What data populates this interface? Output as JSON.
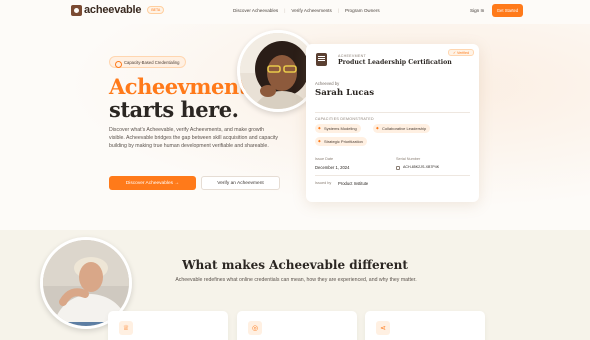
{
  "nav": {
    "logo": "acheevable",
    "beta": "BETA",
    "links": [
      "Discover Acheevables",
      "Verify Acheevments",
      "Program Owners"
    ],
    "sign_in": "Sign In",
    "get_started": "Get Started"
  },
  "hero": {
    "badge": "Capacity-Based Credentialing",
    "title_accent": "Acheevment",
    "title_rest": "starts here.",
    "description": "Discover what's Acheevable, verify Acheevments, and make growth visible. Acheevable bridges the gap between skill acquisition and capacity building by making true human development verifiable and shareable.",
    "primary_button": "Discover Acheevables →",
    "secondary_button": "Verify an Acheevment"
  },
  "credential": {
    "kicker": "ACHEEVMENT",
    "title": "Product Leadership Certification",
    "verified": "✓ Verified",
    "achieved_by_label": "Acheeved by",
    "achiever": "Sarah Lucas",
    "capacities_label": "CAPACITIES DEMONSTRATED",
    "capacities": [
      "Systems Modeling",
      "Collaborative Leadership",
      "Strategic Prioritization"
    ],
    "issue_date_label": "Issue Date",
    "issue_date": "December 1, 2024",
    "serial_label": "Serial Number",
    "serial": "ACH-85K2JS-XB7P4K",
    "issued_by_label": "Issued by",
    "issued_by": "Product Institute"
  },
  "section2": {
    "title": "What makes Acheevable different",
    "subtitle": "Acheevable redefines what online credentials can mean, how they are experienced, and why they matter."
  },
  "colors": {
    "accent": "#ff7a1a",
    "brand_brown": "#5a4032",
    "background": "#fdfbf8",
    "section_bg": "#f6f3ea"
  },
  "icons": {
    "feature_1": "award-icon",
    "feature_2": "target-icon",
    "feature_3": "share-icon"
  }
}
